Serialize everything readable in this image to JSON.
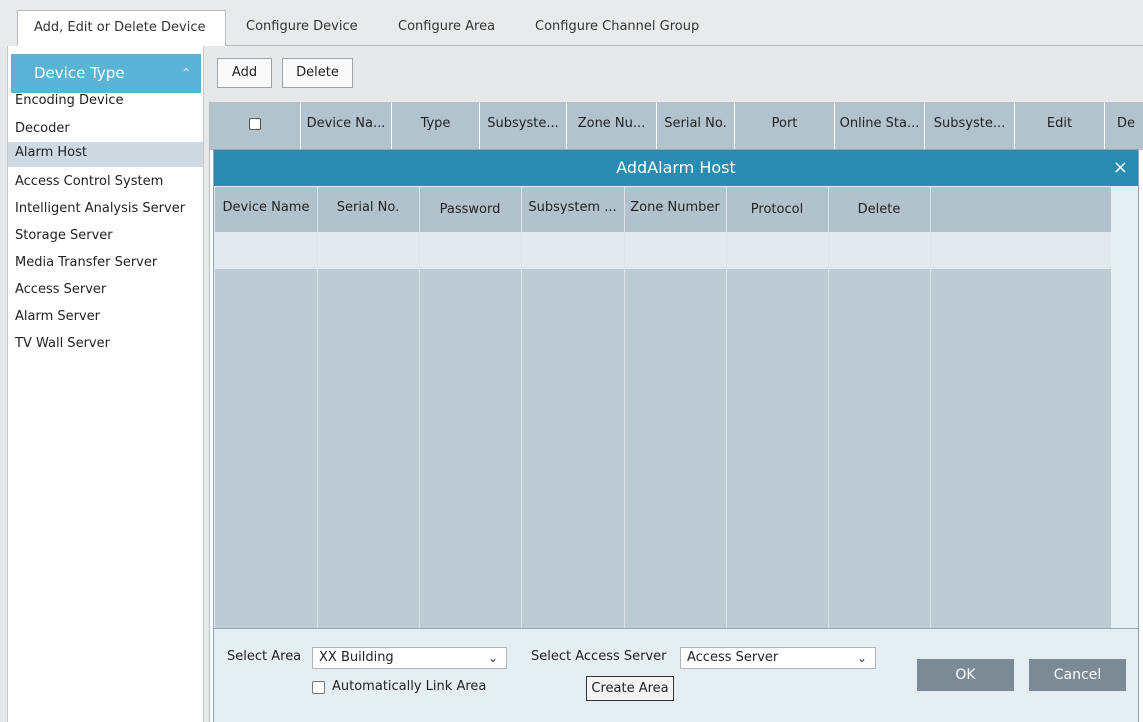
{
  "tabs": [
    "Add, Edit or Delete Device",
    "Configure Device",
    "Configure Area",
    "Configure Channel Group"
  ],
  "sidebar": {
    "header": "Device Type",
    "items": [
      "Encoding Device",
      "Decoder",
      "Alarm Host",
      "Access Control System",
      "Intelligent Analysis Server",
      "Storage Server",
      "Media Transfer Server",
      "Access Server",
      "Alarm Server",
      "TV Wall Server"
    ],
    "selected": "Alarm Host"
  },
  "toolbar": {
    "add": "Add",
    "delete": "Delete"
  },
  "device_table": {
    "columns": [
      "Device Na...",
      "Type",
      "Subsyste...",
      "Zone Nu...",
      "Serial No.",
      "Port",
      "Online Sta...",
      "Subsyste...",
      "Edit",
      "De"
    ]
  },
  "dialog": {
    "title": "AddAlarm Host",
    "close": "×",
    "columns": [
      "Device Name",
      "Serial No.",
      "Password",
      "Subsystem ...",
      "Zone Number",
      "Protocol",
      "Delete"
    ],
    "select_area_label": "Select Area",
    "select_area_value": "XX Building",
    "select_access_label": "Select Access Server",
    "select_access_value": "Access Server",
    "auto_link_label": "Automatically Link Area",
    "create_area": "Create Area",
    "ok": "OK",
    "cancel": "Cancel"
  }
}
